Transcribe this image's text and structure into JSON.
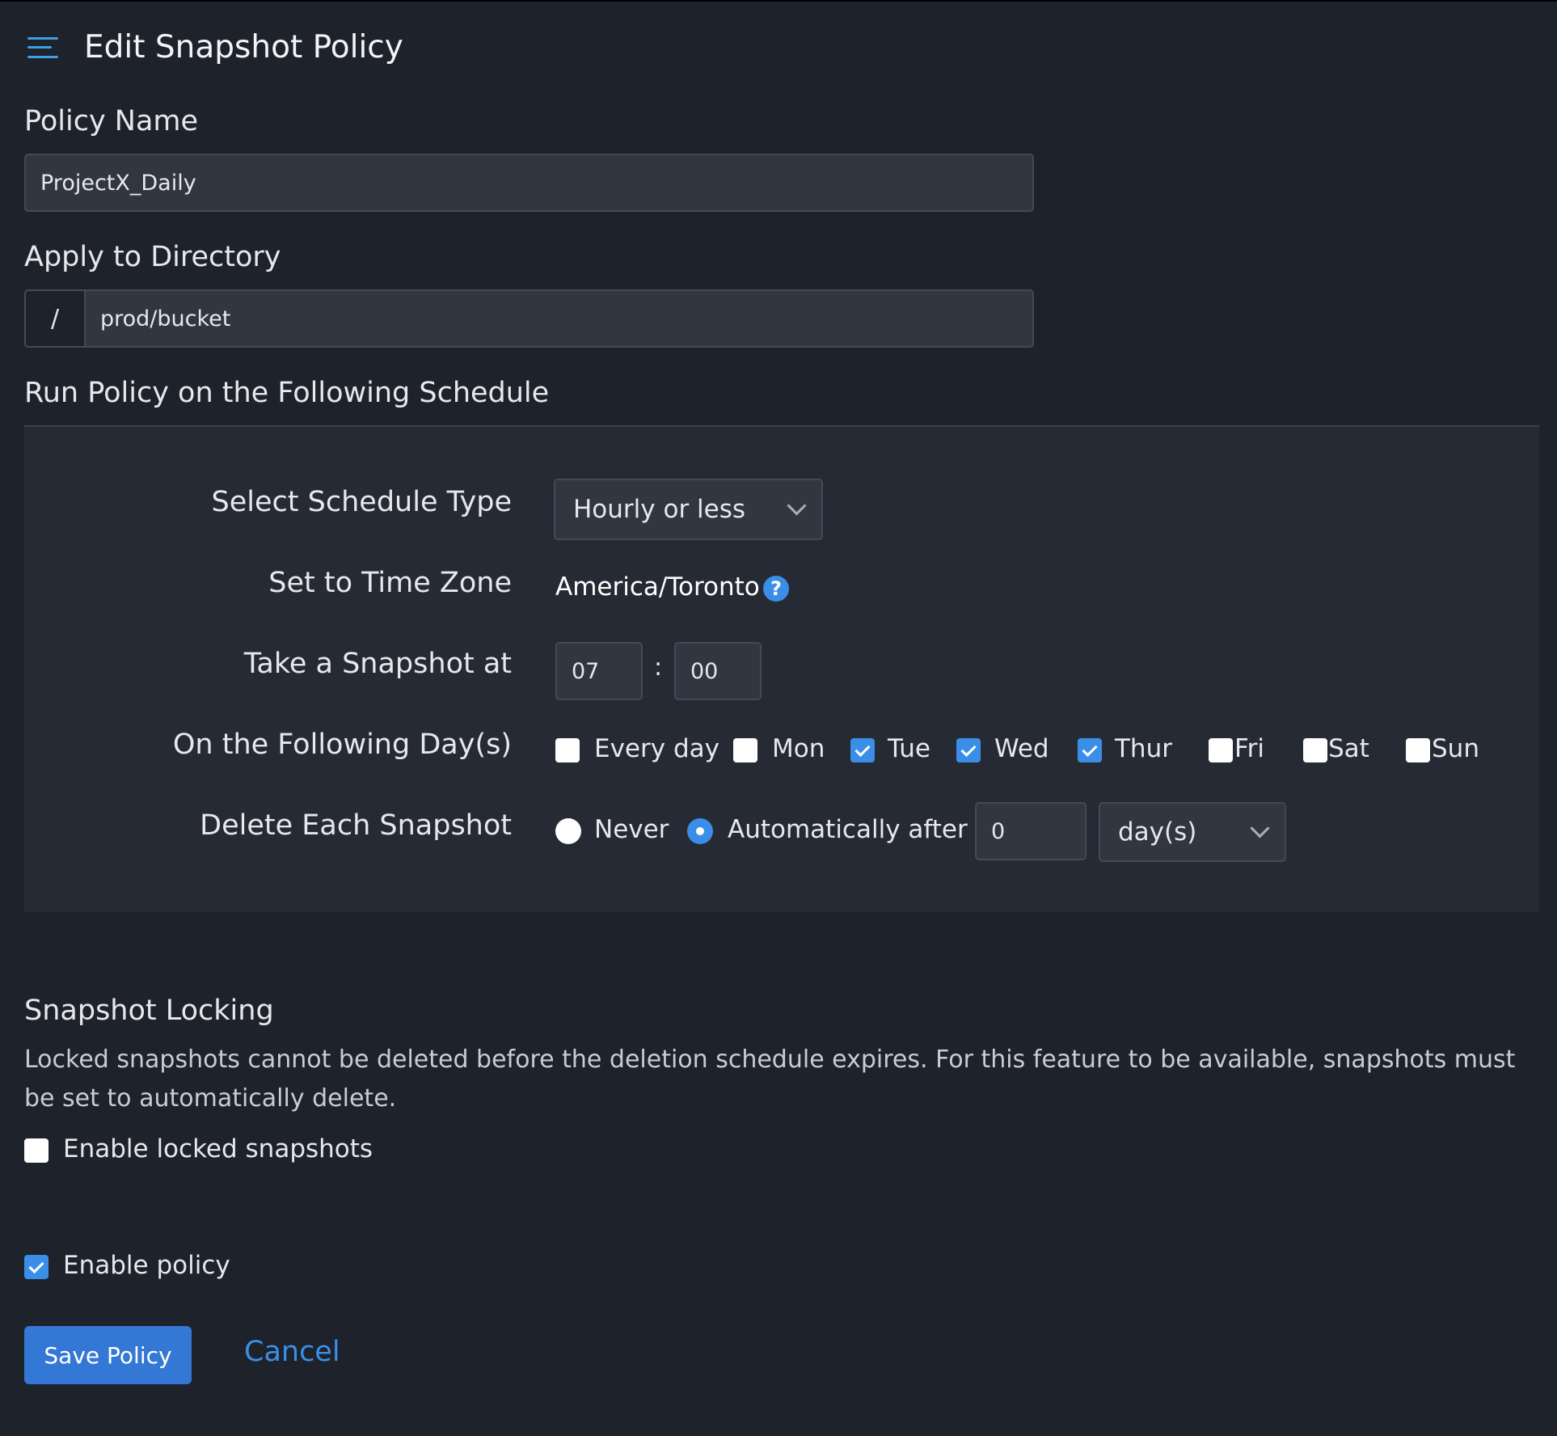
{
  "header": {
    "menu_icon": "hamburger-menu-icon",
    "title": "Edit Snapshot Policy"
  },
  "policy_name": {
    "label": "Policy Name",
    "value": "ProjectX_Daily"
  },
  "directory": {
    "label": "Apply to Directory",
    "prefix": "/",
    "value": "prod/bucket"
  },
  "schedule": {
    "heading": "Run Policy on the Following Schedule",
    "type_label": "Select Schedule Type",
    "type_value": "Hourly or less",
    "timezone_label": "Set to Time Zone",
    "timezone_value": "America/Toronto",
    "help_icon": "question-circle-icon",
    "time_label": "Take a Snapshot at",
    "hour": "07",
    "separator": ":",
    "minute": "00",
    "days_label": "On the Following Day(s)",
    "days": [
      {
        "label": "Every day",
        "checked": false
      },
      {
        "label": "Mon",
        "checked": false
      },
      {
        "label": "Tue",
        "checked": true
      },
      {
        "label": "Wed",
        "checked": true
      },
      {
        "label": "Thur",
        "checked": true
      },
      {
        "label": "Fri",
        "checked": false
      },
      {
        "label": "Sat",
        "checked": false
      },
      {
        "label": "Sun",
        "checked": false
      }
    ],
    "delete_label": "Delete Each Snapshot",
    "delete_never": "Never",
    "delete_auto": "Automatically after",
    "delete_selected": "auto",
    "delete_amount": "0",
    "delete_unit": "day(s)"
  },
  "locking": {
    "heading": "Snapshot Locking",
    "description": "Locked snapshots cannot be deleted before the deletion schedule expires. For this feature to be available, snapshots must be set to automatically delete.",
    "checkbox_label": "Enable locked snapshots",
    "checked": false
  },
  "enable_policy": {
    "label": "Enable policy",
    "checked": true
  },
  "actions": {
    "save": "Save Policy",
    "cancel": "Cancel"
  },
  "colors": {
    "background": "#1e222b",
    "panel": "#262a34",
    "input": "#313640",
    "accent": "#3b8ee8",
    "primary_button": "#3478d6"
  }
}
